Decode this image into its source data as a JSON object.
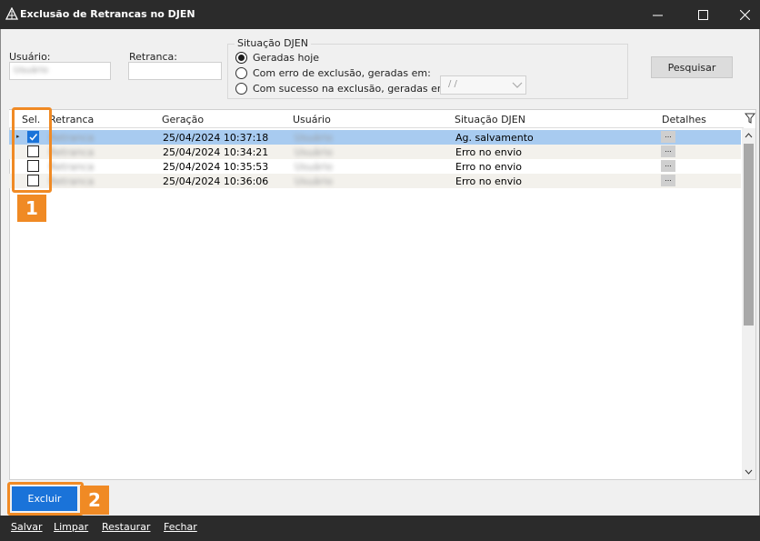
{
  "window": {
    "title": "Exclusão de Retrancas no DJEN"
  },
  "filters": {
    "usuario_label": "Usuário:",
    "usuario_value": "Usuário",
    "retranca_label": "Retranca:",
    "retranca_value": "",
    "situacao_title": "Situação DJEN",
    "options": [
      {
        "label": "Geradas hoje",
        "selected": true
      },
      {
        "label": "Com erro de exclusão, geradas em:",
        "selected": false
      },
      {
        "label": "Com sucesso na exclusão, geradas em:",
        "selected": false
      }
    ],
    "date_value": "/ /",
    "search_button": "Pesquisar"
  },
  "grid": {
    "headers": [
      "Sel.",
      "Retranca",
      "Geração",
      "Usuário",
      "Situação DJEN",
      "Detalhes"
    ],
    "rows": [
      {
        "selected": true,
        "retranca": "Retranca",
        "geracao": "25/04/2024 10:37:18",
        "usuario": "Usuário",
        "situacao": "Ag. salvamento",
        "detalhes": "..."
      },
      {
        "selected": false,
        "retranca": "Retranca",
        "geracao": "25/04/2024 10:34:21",
        "usuario": "Usuário",
        "situacao": "Erro no envio",
        "detalhes": "..."
      },
      {
        "selected": false,
        "retranca": "Retranca",
        "geracao": "25/04/2024 10:35:53",
        "usuario": "Usuário",
        "situacao": "Erro no envio",
        "detalhes": "..."
      },
      {
        "selected": false,
        "retranca": "Retranca",
        "geracao": "25/04/2024 10:36:06",
        "usuario": "Usuário",
        "situacao": "Erro no envio",
        "detalhes": "..."
      }
    ]
  },
  "annotations": {
    "badge1": "1",
    "badge2": "2"
  },
  "actions": {
    "excluir": "Excluir"
  },
  "menu": [
    "Salvar",
    "Limpar",
    "Restaurar",
    "Fechar"
  ],
  "colors": {
    "accent": "#1a73d9",
    "highlight": "#f08a24",
    "selected_row": "#a8cbf0",
    "titlebar": "#2b2b2b"
  }
}
